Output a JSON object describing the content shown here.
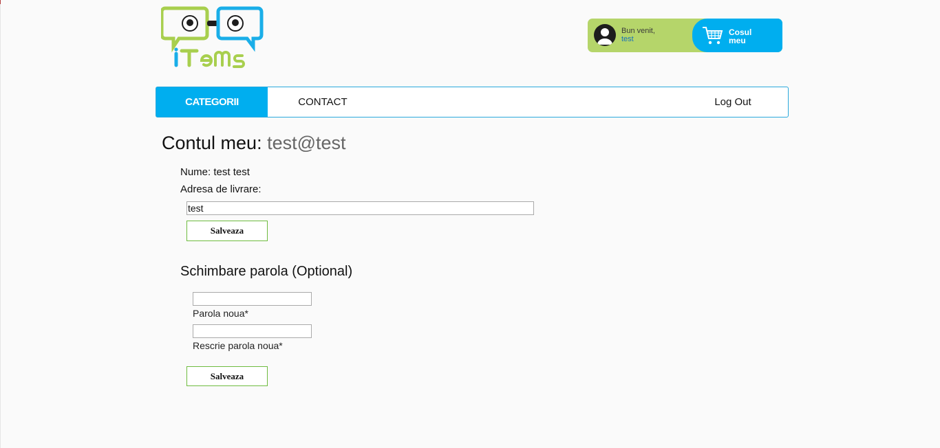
{
  "brand": {
    "logo_text": "iTems",
    "green": "#b5d56a",
    "blue": "#00aeef"
  },
  "header": {
    "welcome_text": "Bun venit,",
    "username": "test",
    "cart_label_line1": "Cosul",
    "cart_label_line2": "meu",
    "icons": {
      "avatar": "user-avatar-icon",
      "cart": "shopping-cart-icon"
    }
  },
  "nav": {
    "categories": "CATEGORII",
    "contact": "CONTACT",
    "logout": "Log Out"
  },
  "account": {
    "title": "Contul meu:",
    "email": "test@test",
    "name_line": "Nume: test test",
    "address_label": "Adresa de livrare:",
    "address_value": "test",
    "save_label": "Salveaza"
  },
  "password": {
    "title": "Schimbare parola (Optional)",
    "new_password_label": "Parola noua*",
    "new_password_value": "",
    "repeat_password_label": "Rescrie parola noua*",
    "repeat_password_value": "",
    "save_label": "Salveaza"
  }
}
